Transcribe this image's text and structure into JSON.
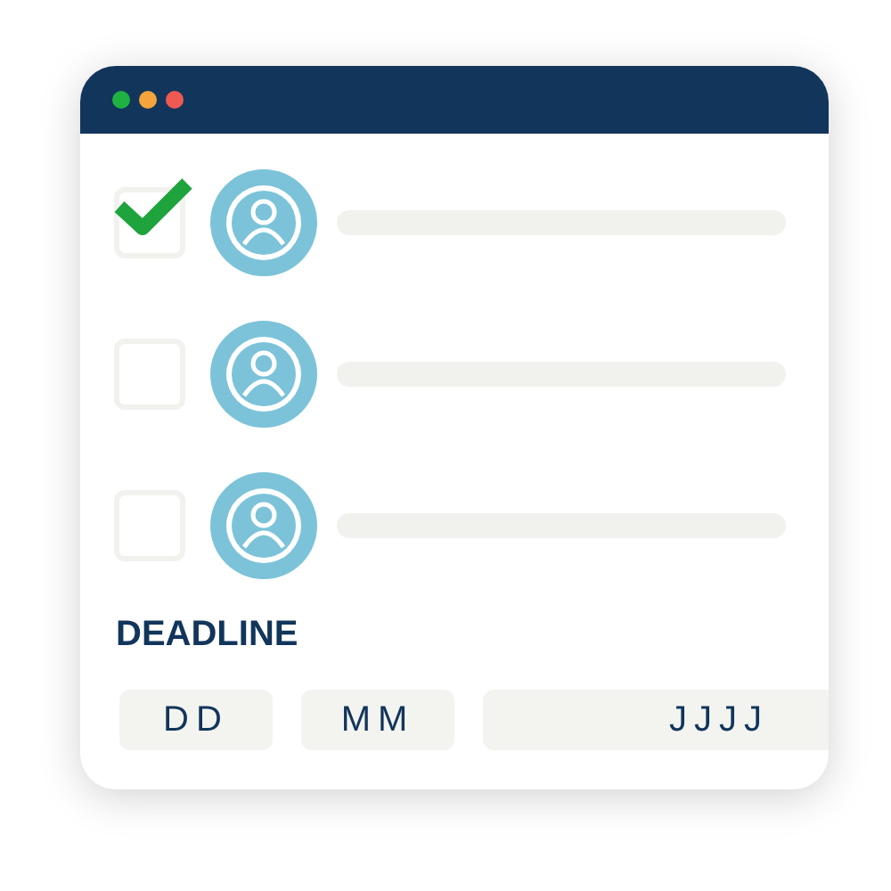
{
  "window": {
    "dots": [
      {
        "color": "#1fb141"
      },
      {
        "color": "#f5a43b"
      },
      {
        "color": "#ee5a52"
      }
    ]
  },
  "rows": [
    {
      "checked": true
    },
    {
      "checked": false
    },
    {
      "checked": false
    }
  ],
  "deadline": {
    "label": "DEADLINE",
    "fields": [
      {
        "placeholder": "DD"
      },
      {
        "placeholder": "MM"
      },
      {
        "placeholder": "JJJJ"
      }
    ]
  }
}
